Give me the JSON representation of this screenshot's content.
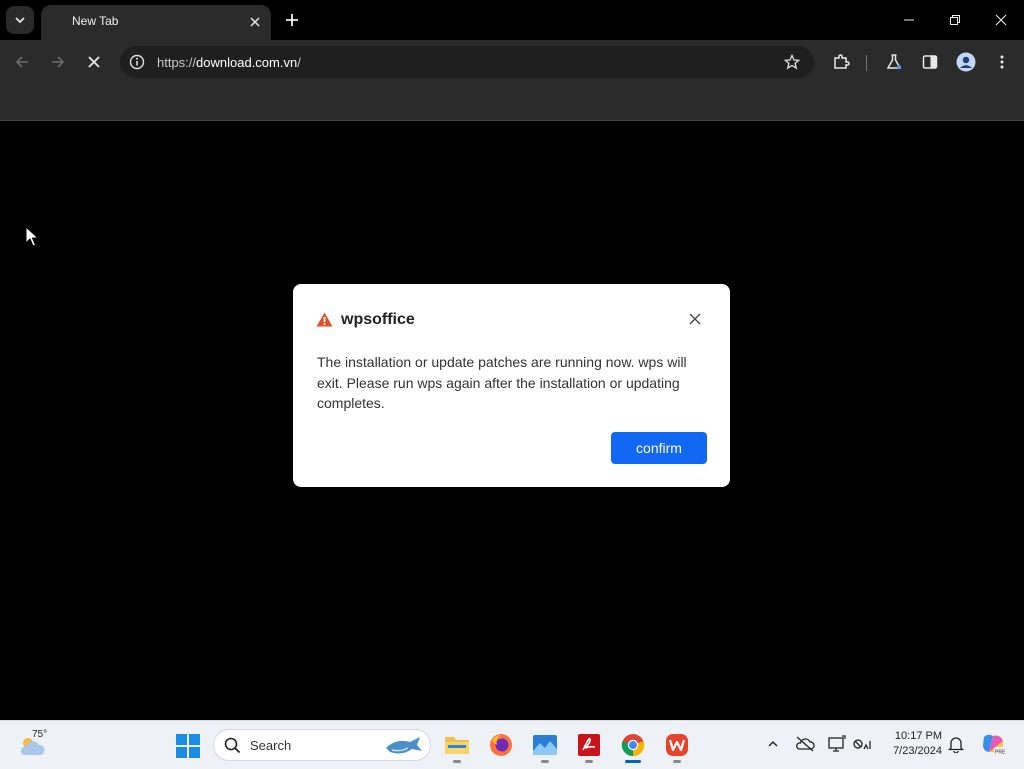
{
  "browser": {
    "tab_title": "New Tab",
    "url_scheme": "https://",
    "url_host": "download.com.vn",
    "url_path": "/"
  },
  "dialog": {
    "title": "wpsoffice",
    "message": "The installation or update patches are running now. wps will exit. Please run wps again after the installation or updating completes.",
    "confirm_label": "confirm"
  },
  "taskbar": {
    "weather_temp": "75°",
    "search_placeholder": "Search",
    "time": "10:17 PM",
    "date": "7/23/2024"
  },
  "colors": {
    "dialog_button": "#1268f3",
    "browser_chrome": "#2b2b2b",
    "warning": "#e0512b"
  }
}
